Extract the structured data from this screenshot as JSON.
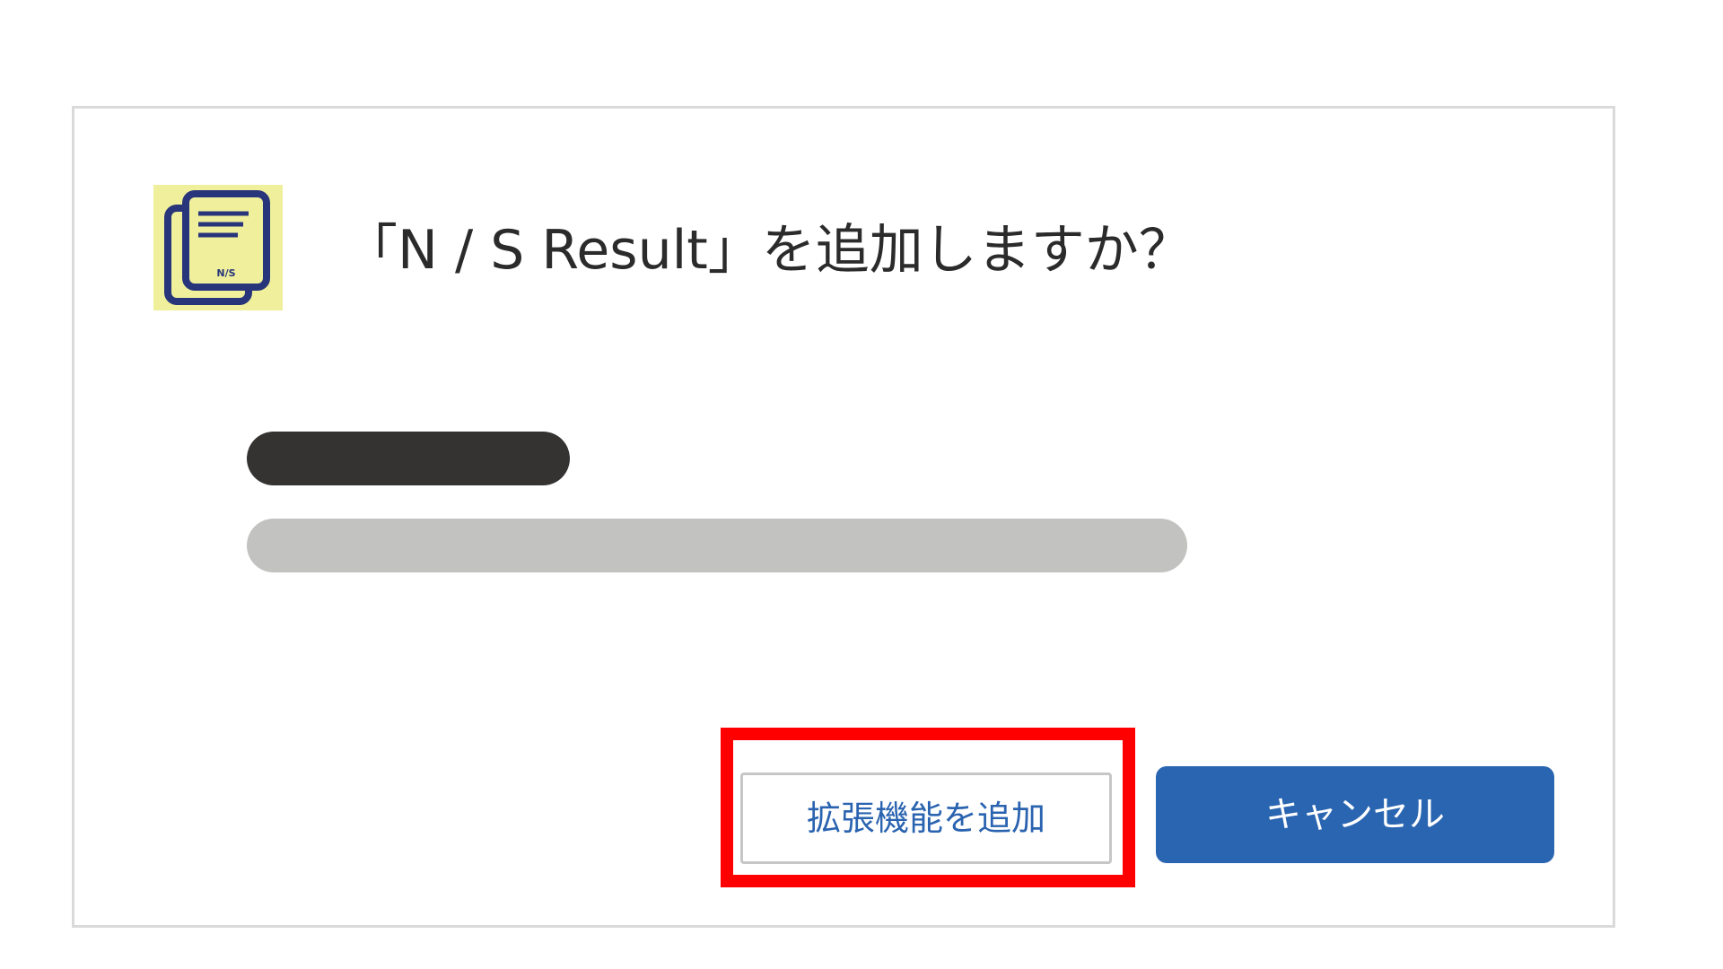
{
  "dialog": {
    "title": "「N / S Result」を追加しますか？",
    "icon": {
      "name": "document-stack-icon",
      "label": "N/S",
      "background_color": "#efef9c",
      "stroke_color": "#28357a"
    }
  },
  "buttons": {
    "add_label": "拡張機能を追加",
    "cancel_label": "キャンセル"
  },
  "colors": {
    "highlight": "#ff0000",
    "primary_button": "#2a65b1",
    "link_text": "#2a63b0"
  }
}
